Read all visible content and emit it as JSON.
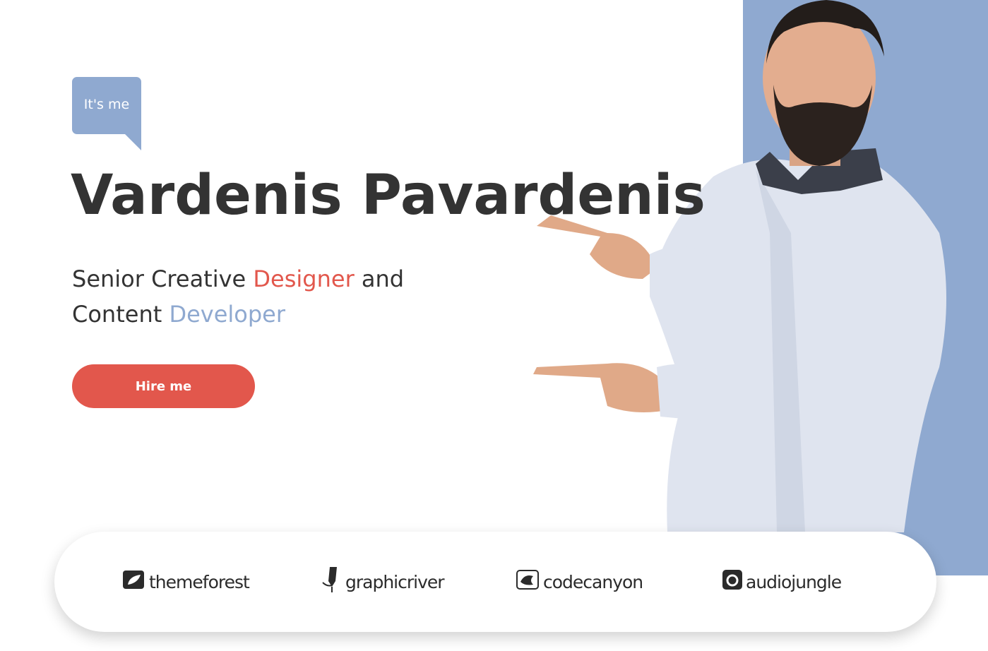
{
  "hero": {
    "bubble": "It's me",
    "name": "Vardenis Pavardenis",
    "tagline": {
      "part1": "Senior Creative ",
      "highlight1": "Designer",
      "part2": " and",
      "part3": "Content ",
      "highlight2": "Developer"
    },
    "cta_label": "Hire me"
  },
  "partners": [
    {
      "label": "themeforest",
      "icon": "themeforest-leaf-icon"
    },
    {
      "label": "graphicriver",
      "icon": "graphicriver-pen-icon"
    },
    {
      "label": "codecanyon",
      "icon": "codecanyon-bird-icon"
    },
    {
      "label": "audiojungle",
      "icon": "audiojungle-swirl-icon"
    }
  ],
  "colors": {
    "accent_red": "#e2574c",
    "accent_blue": "#8fa9d0",
    "text_dark": "#333333"
  }
}
